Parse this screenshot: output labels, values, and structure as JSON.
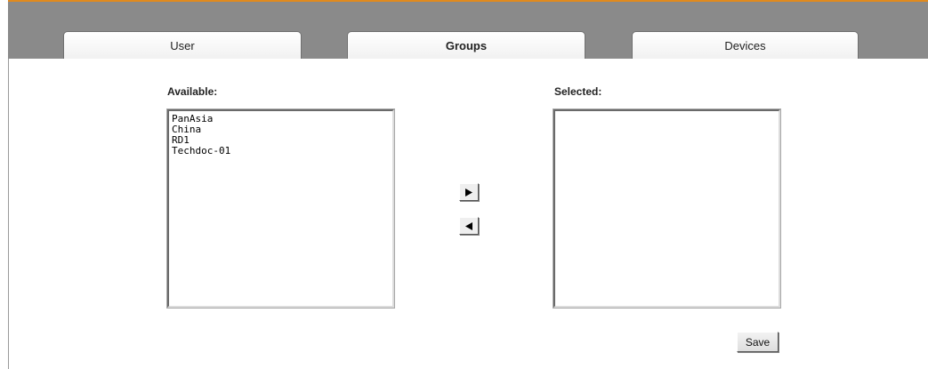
{
  "tabs": [
    {
      "label": "User",
      "active": false
    },
    {
      "label": "Groups",
      "active": true
    },
    {
      "label": "Devices",
      "active": false
    }
  ],
  "available": {
    "label": "Available:",
    "items": [
      "PanAsia",
      "China",
      "RD1",
      "Techdoc-01"
    ]
  },
  "selected": {
    "label": "Selected:",
    "items": []
  },
  "buttons": {
    "add_icon": "right-triangle-arrow",
    "remove_icon": "left-triangle-arrow",
    "save_label": "Save"
  },
  "colors": {
    "tabbar": "#8a8a8a",
    "accent_rule": "#e08a1e"
  }
}
